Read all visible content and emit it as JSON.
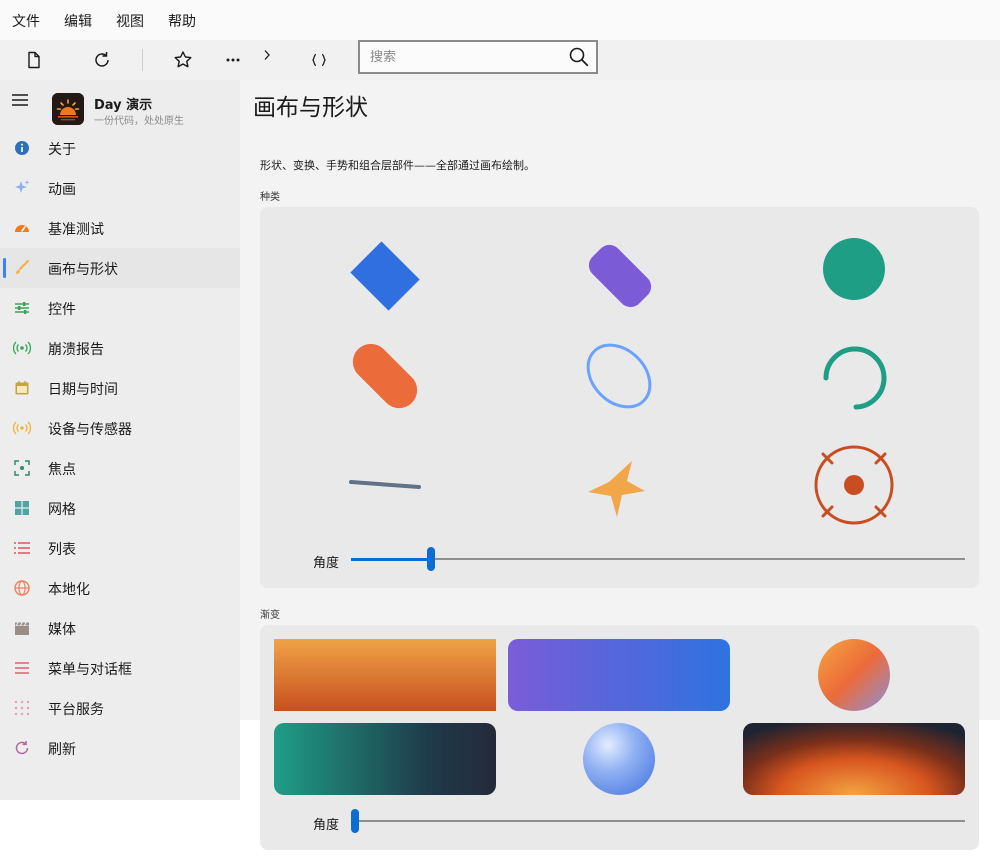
{
  "menubar": {
    "items": [
      "文件",
      "编辑",
      "视图",
      "帮助"
    ]
  },
  "toolbar": {
    "search": {
      "placeholder": "搜索",
      "value": ""
    }
  },
  "app": {
    "title": "Day 演示",
    "subtitle": "一份代码，处处原生"
  },
  "sidebar": {
    "items": [
      {
        "label": "关于",
        "icon": "info-icon",
        "color": "#2f6fb7"
      },
      {
        "label": "动画",
        "icon": "sparkle-icon",
        "color": "#8ab4e8"
      },
      {
        "label": "基准测试",
        "icon": "gauge-icon",
        "color": "#f07c1e"
      },
      {
        "label": "画布与形状",
        "icon": "brush-icon",
        "color": "#f5b24a",
        "active": true
      },
      {
        "label": "控件",
        "icon": "sliders-icon",
        "color": "#3aa55a"
      },
      {
        "label": "崩溃报告",
        "icon": "broadcast-icon",
        "color": "#3aa55a"
      },
      {
        "label": "日期与时间",
        "icon": "calendar-icon",
        "color": "#c7a43a"
      },
      {
        "label": "设备与传感器",
        "icon": "broadcast-icon",
        "color": "#f0b43a"
      },
      {
        "label": "焦点",
        "icon": "focus-icon",
        "color": "#2d8a6e"
      },
      {
        "label": "网格",
        "icon": "grid-icon",
        "color": "#4fa3a3"
      },
      {
        "label": "列表",
        "icon": "list-icon",
        "color": "#e0555a"
      },
      {
        "label": "本地化",
        "icon": "globe-icon",
        "color": "#f08060"
      },
      {
        "label": "媒体",
        "icon": "clapper-icon",
        "color": "#9a8f86"
      },
      {
        "label": "菜单与对话框",
        "icon": "menu-icon",
        "color": "#e06070"
      },
      {
        "label": "平台服务",
        "icon": "dots-grid-icon",
        "color": "#e0a0b0"
      },
      {
        "label": "刷新",
        "icon": "refresh-icon",
        "color": "#b06aa0"
      }
    ]
  },
  "page": {
    "title": "画布与形状",
    "description": "形状、变换、手势和组合层部件——全部通过画布绘制。",
    "sections": {
      "kinds": {
        "label": "种类",
        "slider_label": "角度",
        "slider_value": 0.13
      },
      "gradients": {
        "label": "渐变",
        "slider_label": "角度",
        "slider_value": 0.0
      }
    }
  },
  "colors": {
    "accent": "#0a6ed1",
    "rect_blue": "#2f6fe0",
    "pill_purple": "#7b5cd6",
    "circle_teal": "#1f9e86",
    "pill_orange": "#ec6b3a",
    "ring_blue": "#6aa3ff",
    "arc_teal": "#1f9e86",
    "line_slate": "#5f7288",
    "star_orange": "#f2a64a",
    "target_red": "#c84e22"
  }
}
